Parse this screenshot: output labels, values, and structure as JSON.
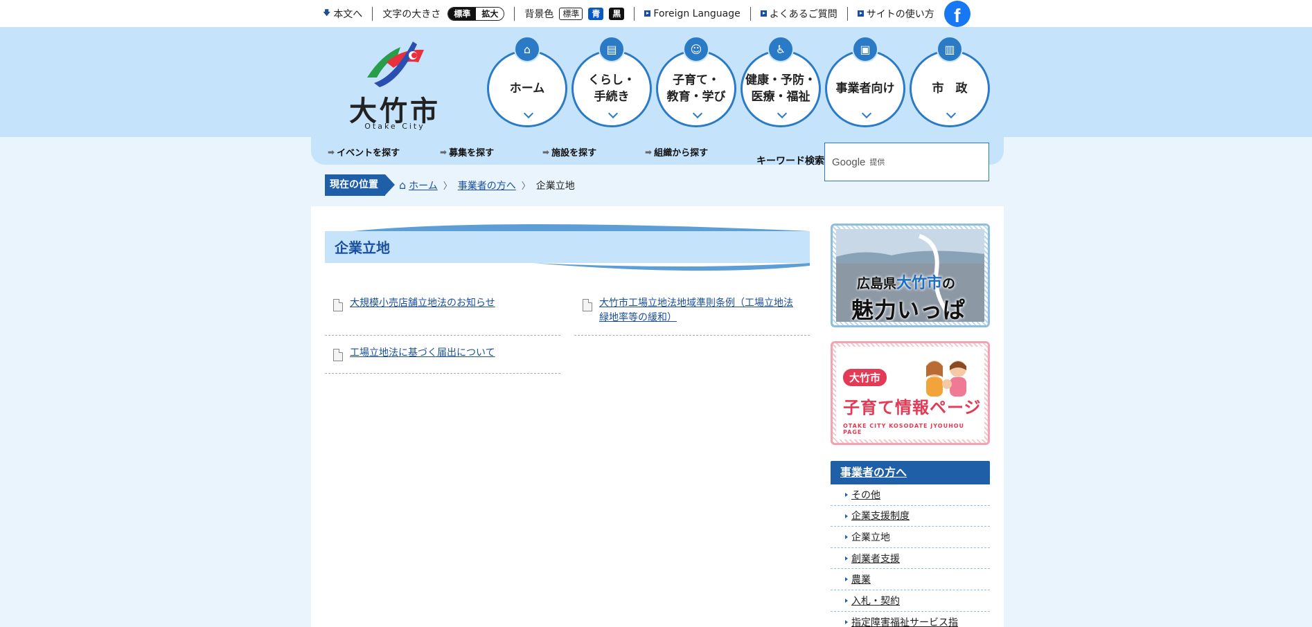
{
  "topbar": {
    "skip_link": "本文へ",
    "font_size_label": "文字の大きさ",
    "font_size_options": [
      "標準",
      "拡大"
    ],
    "bg_color_label": "背景色",
    "bg_color_options": [
      "標準",
      "青",
      "黒"
    ],
    "foreign_language": "Foreign Language",
    "faq": "よくあるご質問",
    "site_usage": "サイトの使い方",
    "facebook_icon": "f"
  },
  "logo": {
    "name": "大竹市",
    "sub": "Otake City"
  },
  "global_nav": [
    {
      "label": "ホーム",
      "icon": "home-icon"
    },
    {
      "label": "くらし・\n手続き",
      "icon": "document-icon"
    },
    {
      "label": "子育て・\n教育・学び",
      "icon": "child-icon"
    },
    {
      "label": "健康・予防・\n医療・福祉",
      "icon": "wheelchair-icon"
    },
    {
      "label": "事業者向け",
      "icon": "briefcase-icon"
    },
    {
      "label": "市　政",
      "icon": "building-icon"
    }
  ],
  "sub_nav": [
    {
      "label": "イベントを探す"
    },
    {
      "label": "募集を探す"
    },
    {
      "label": "施設を探す"
    },
    {
      "label": "組織から探す"
    }
  ],
  "search": {
    "label": "キーワード検索",
    "google": "Google",
    "provided": "提供"
  },
  "breadcrumb": {
    "tag": "現在の位置",
    "home": "ホーム",
    "parent": "事業者の方へ",
    "current": "企業立地"
  },
  "page": {
    "title": "企業立地",
    "documents": [
      {
        "label": "大規模小売店舗立地法のお知らせ"
      },
      {
        "label": "大竹市工場立地法地域準則条例（工場立地法緑地率等の緩和）"
      },
      {
        "label": "工場立地法に基づく届出について"
      }
    ]
  },
  "banners": {
    "b1_line1_pre": "広島県",
    "b1_line1_city": "大竹市",
    "b1_line1_post": "の",
    "b1_line2": "魅力いっぱい",
    "b2_pill": "大竹市",
    "b2_title": "子育て情報ページ",
    "b2_sub": "OTAKE CITY KOSODATE JYOUHOU PAGE"
  },
  "side_nav": {
    "heading": "事業者の方へ",
    "items": [
      "その他",
      "企業支援制度",
      "企業立地",
      "創業者支援",
      "農業",
      "入札・契約",
      "指定障害福祉サービス指"
    ]
  },
  "colors": {
    "header_bg": "#c5e3fb",
    "accent": "#2b7ac6",
    "dark_blue": "#1e5fa7",
    "page_bg": "#eaf4fd"
  }
}
